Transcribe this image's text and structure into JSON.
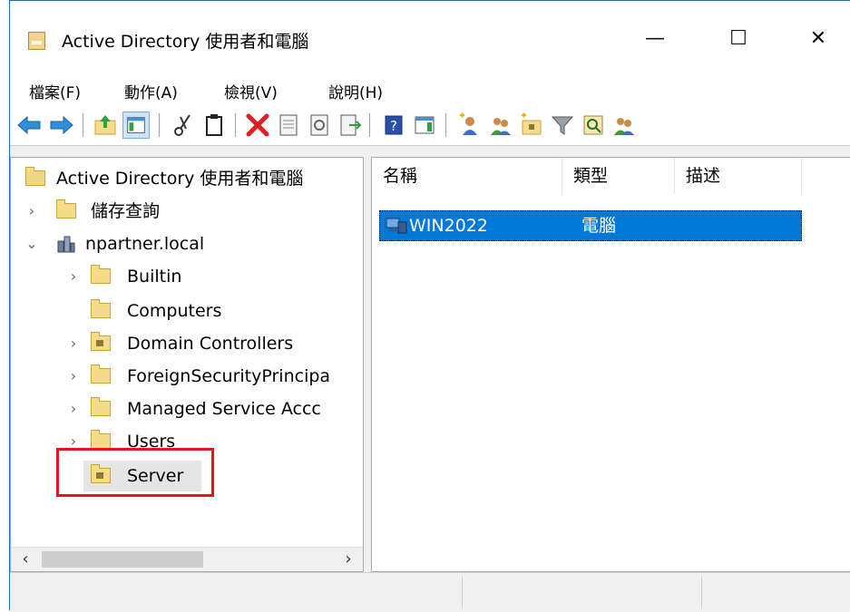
{
  "window": {
    "title": "Active Directory 使用者和電腦",
    "controls": {
      "minimize": "—",
      "maximize": "☐",
      "close": "✕"
    }
  },
  "menu": [
    "檔案(F)",
    "動作(A)",
    "檢視(V)",
    "說明(H)"
  ],
  "toolbar": {
    "buttons": [
      "back-icon",
      "forward-icon",
      "up-folder-icon",
      "show-console-tree-icon",
      "cut-icon",
      "paste-icon",
      "delete-icon",
      "properties-icon",
      "refresh-icon",
      "export-list-icon",
      "help-icon",
      "show-action-pane-icon",
      "new-user-icon",
      "new-group-icon",
      "new-ou-icon",
      "filter-icon",
      "find-icon",
      "add-to-group-icon"
    ]
  },
  "tree": {
    "root": "Active Directory 使用者和電腦",
    "saved_queries": "儲存查詢",
    "domain": "npartner.local",
    "children": [
      "Builtin",
      "Computers",
      "Domain Controllers",
      "ForeignSecurityPrincipa",
      "Managed Service Accc",
      "Users",
      "Server"
    ],
    "selected": "Server"
  },
  "list": {
    "columns": [
      "名稱",
      "類型",
      "描述"
    ],
    "rows": [
      {
        "name": "WIN2022",
        "type": "電腦",
        "description": ""
      }
    ]
  },
  "colors": {
    "selection": "#0078d7",
    "highlight_box": "#e5151b",
    "window_border": "#2b6aa8"
  }
}
